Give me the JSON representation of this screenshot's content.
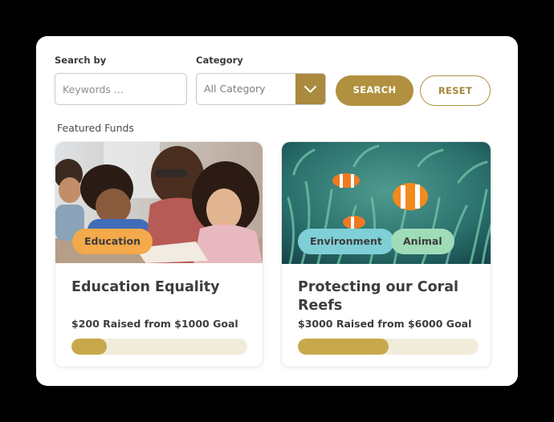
{
  "search": {
    "search_by_label": "Search by",
    "keywords_placeholder": "Keywords ...",
    "category_label": "Category",
    "category_value": "All Category",
    "search_button": "SEARCH",
    "reset_button": "RESET"
  },
  "featured": {
    "title": "Featured Funds",
    "cards": [
      {
        "tags": [
          "Education"
        ],
        "title": "Education Equality",
        "raised_text": "$200 Raised from $1000 Goal",
        "progress_fraction": 0.2
      },
      {
        "tags": [
          "Environment",
          "Animal"
        ],
        "title": "Protecting our Coral Reefs",
        "raised_text": "$3000 Raised from $6000 Goal",
        "progress_fraction": 0.5
      }
    ]
  },
  "colors": {
    "accent": "#b1913f",
    "progress_fill": "#c8a84c",
    "progress_track": "#f1ecda",
    "tag_education": "#f4a94a",
    "tag_environment": "#7fcfd6",
    "tag_animal": "#9fdcb8"
  },
  "icons": {
    "category_dropdown": "chevron-down-icon"
  }
}
